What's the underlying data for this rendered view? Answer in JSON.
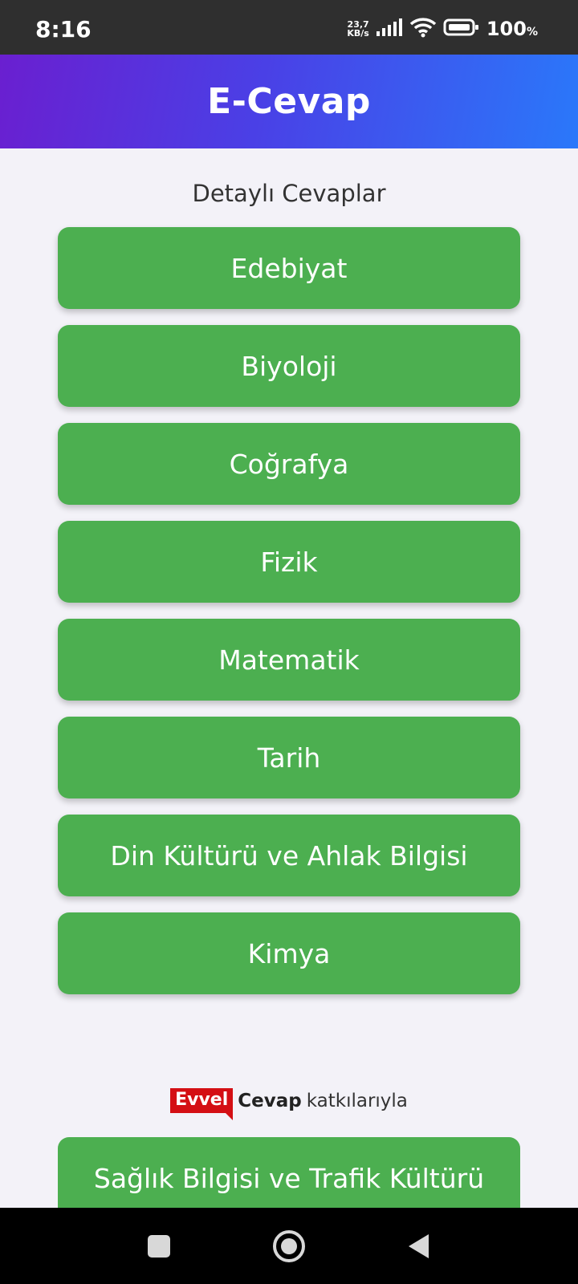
{
  "status_bar": {
    "time": "8:16",
    "net_speed_value": "23,7",
    "net_speed_unit": "KB/s",
    "battery_percent": "100",
    "battery_unit": "%"
  },
  "header": {
    "title": "E-Cevap"
  },
  "main": {
    "section_label": "Detaylı Cevaplar",
    "subjects": [
      "Edebiyat",
      "Biyoloji",
      "Coğrafya",
      "Fizik",
      "Matematik",
      "Tarih",
      "Din Kültürü ve Ahlak Bilgisi",
      "Kimya"
    ]
  },
  "partner": {
    "logo_part1": "Evvel",
    "logo_part2": "Cevap",
    "text": "katkılarıyla",
    "brand_color": "#d40f14"
  },
  "extra": {
    "subject": "Sağlık Bilgisi ve Trafik Kültürü"
  },
  "colors": {
    "button_green": "#4caf50",
    "header_gradient_start": "#6a1fd0",
    "header_gradient_end": "#2a78fa"
  },
  "nav": {
    "icons": [
      "recent-apps-icon",
      "home-icon",
      "back-icon"
    ]
  }
}
